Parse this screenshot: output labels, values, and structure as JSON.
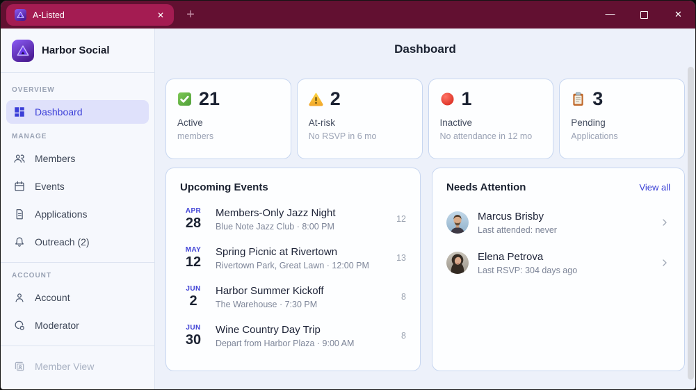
{
  "colors": {
    "titlebar_bg": "#621031",
    "tab_bg": "#a41c52",
    "accent_indigo": "#3b3fd8",
    "active_item_bg": "#dfe1fb",
    "status_active_green": "#5bab45",
    "status_warning_yellow": "#f5b82e",
    "status_inactive_red": "#e8453a",
    "clipboard_brown": "#c0692b",
    "page_bg": "#edf1fa",
    "card_bg": "#fdfeff",
    "card_border": "#c7d6f0"
  },
  "titlebar": {
    "tab_title": "A-Listed",
    "tab_close_glyph": "✕",
    "new_tab_glyph": "+",
    "minimize_glyph": "—",
    "close_glyph": "✕"
  },
  "sidebar": {
    "brand": "Harbor Social",
    "sections": [
      {
        "label": "OVERVIEW",
        "items": [
          {
            "label": "Dashboard",
            "icon": "dashboard-grid",
            "active": true
          }
        ]
      },
      {
        "label": "MANAGE",
        "items": [
          {
            "label": "Members",
            "icon": "people"
          },
          {
            "label": "Events",
            "icon": "calendar"
          },
          {
            "label": "Applications",
            "icon": "document"
          },
          {
            "label": "Outreach (2)",
            "icon": "bell"
          }
        ]
      },
      {
        "label": "ACCOUNT",
        "items": [
          {
            "label": "Account",
            "icon": "person"
          },
          {
            "label": "Moderator",
            "icon": "user-badge"
          }
        ]
      },
      {
        "label": "",
        "items": [
          {
            "label": "Member View",
            "icon": "id-card",
            "disabled": true
          }
        ]
      }
    ]
  },
  "main": {
    "title": "Dashboard",
    "stats": [
      {
        "icon": "green-check",
        "value": "21",
        "label": "Active",
        "sub": "members"
      },
      {
        "icon": "warning-triangle",
        "value": "2",
        "label": "At-risk",
        "sub": "No RSVP in 6 mo"
      },
      {
        "icon": "red-circle",
        "value": "1",
        "label": "Inactive",
        "sub": "No attendance in 12 mo"
      },
      {
        "icon": "clipboard",
        "value": "3",
        "label": "Pending",
        "sub": "Applications"
      }
    ],
    "upcoming_events": {
      "title": "Upcoming Events",
      "events": [
        {
          "month": "APR",
          "day": "28",
          "title": "Members-Only Jazz Night",
          "detail": "Blue Note Jazz Club · 8:00 PM",
          "count": "12"
        },
        {
          "month": "MAY",
          "day": "12",
          "title": "Spring Picnic at Rivertown",
          "detail": "Rivertown Park, Great Lawn · 12:00 PM",
          "count": "13"
        },
        {
          "month": "JUN",
          "day": "2",
          "title": "Harbor Summer Kickoff",
          "detail": "The Warehouse · 7:30 PM",
          "count": "8"
        },
        {
          "month": "JUN",
          "day": "30",
          "title": "Wine Country Day Trip",
          "detail": "Depart from Harbor Plaza · 9:00 AM",
          "count": "8"
        }
      ]
    },
    "needs_attention": {
      "title": "Needs Attention",
      "view_all": "View all",
      "people": [
        {
          "name": "Marcus Brisby",
          "detail": "Last attended: never"
        },
        {
          "name": "Elena Petrova",
          "detail": "Last RSVP: 304 days ago"
        }
      ]
    }
  }
}
